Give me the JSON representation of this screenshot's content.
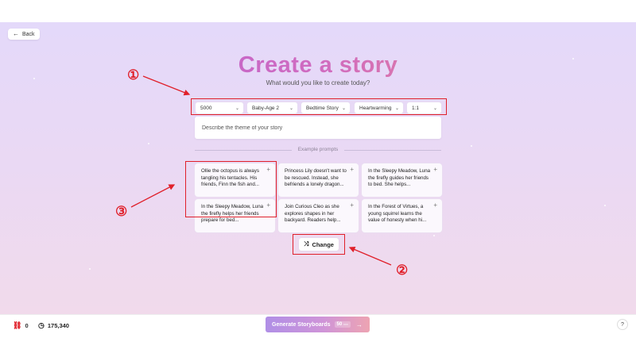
{
  "nav": {
    "back_label": "Back"
  },
  "header": {
    "title": "Create a story",
    "subtitle": "What would you like to create today?"
  },
  "options": [
    {
      "value": "5000"
    },
    {
      "value": "Baby-Age 2"
    },
    {
      "value": "Bedtime Story"
    },
    {
      "value": "Heartwarming"
    },
    {
      "value": "1:1"
    }
  ],
  "theme_input": {
    "placeholder": "Describe the theme of your story",
    "value": ""
  },
  "examples": {
    "label": "Example prompts",
    "prompts": [
      "Ollie the octopus is always tangling his tentacles. His friends, Finn the fish and...",
      "Princess Lily doesn't want to be rescued. Instead, she befriends a lonely dragon...",
      "In the Sleepy Meadow, Luna the firefly guides her friends to bed. She helps...",
      "In the Sleepy Meadow, Luna the firefly helps her friends prepare for bed...",
      "Join Curious Cleo as she explores shapes in her backyard. Readers help...",
      "In the Forest of Virtues, a young squirrel learns the value of honesty when hi..."
    ]
  },
  "change_button": {
    "label": "Change"
  },
  "annotations": {
    "marker_1": "①",
    "marker_2": "②",
    "marker_3": "③"
  },
  "footer": {
    "credits": "0",
    "tokens": "175,340",
    "generate": {
      "label": "Generate Storyboards",
      "cost": "50",
      "cost_sub": "xxx"
    },
    "help": "?"
  },
  "colors": {
    "annotation": "#e0202a",
    "title_gradient_start": "#b15fd8",
    "title_gradient_end": "#ee8f82",
    "generate_gradient_start": "#b08fe6",
    "generate_gradient_end": "#eda4b2"
  },
  "icons": {
    "back": "arrow-left-icon",
    "chevron": "chevron-down-icon",
    "add": "plus-icon",
    "shuffle": "shuffle-icon",
    "credits": "link-icon",
    "tokens": "clock-icon",
    "generate": "arrow-right-icon"
  }
}
